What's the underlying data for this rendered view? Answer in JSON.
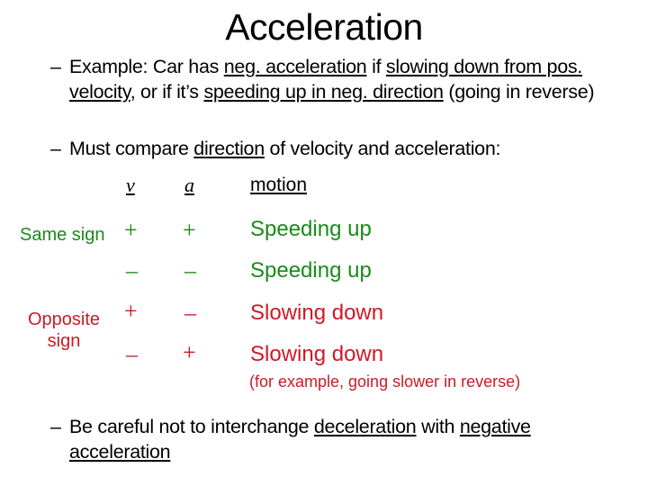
{
  "slide": {
    "title": "Acceleration",
    "bullets": [
      {
        "dash": "–",
        "segments": [
          {
            "text": "Example: Car has ",
            "underline": false
          },
          {
            "text": "neg. acceleration",
            "underline": true
          },
          {
            "text": " if ",
            "underline": false
          },
          {
            "text": "slowing down from pos. velocity",
            "underline": true
          },
          {
            "text": ", or if it’s ",
            "underline": false
          },
          {
            "text": "speeding up in neg. direction",
            "underline": true
          },
          {
            "text": " (going in reverse)",
            "underline": false
          }
        ]
      },
      {
        "dash": "–",
        "segments": [
          {
            "text": "Must compare ",
            "underline": false
          },
          {
            "text": "direction",
            "underline": true
          },
          {
            "text": " of velocity and acceleration:",
            "underline": false
          }
        ]
      },
      {
        "dash": "–",
        "segments": [
          {
            "text": "Be careful not to interchange ",
            "underline": false
          },
          {
            "text": "deceleration",
            "underline": true
          },
          {
            "text": " with ",
            "underline": false
          },
          {
            "text": "negative acceleration",
            "underline": true
          }
        ]
      }
    ],
    "table": {
      "headers": {
        "v": "v",
        "a": "a",
        "motion": "motion"
      },
      "groups": {
        "same": {
          "label": "Same sign",
          "color": "#1a8a1a"
        },
        "opposite": {
          "label": "Opposite sign",
          "label_line1": "Opposite",
          "label_line2": "sign",
          "color": "#cc1a26"
        }
      },
      "rows": [
        {
          "v": "+",
          "a": "+",
          "motion": "Speeding up",
          "group": "same"
        },
        {
          "v": "–",
          "a": "–",
          "motion": "Speeding up",
          "group": "same"
        },
        {
          "v": "+",
          "a": "–",
          "motion": "Slowing down",
          "group": "opposite"
        },
        {
          "v": "–",
          "a": "+",
          "motion": "Slowing down",
          "group": "opposite"
        }
      ],
      "note": "(for example, going slower in reverse)"
    }
  }
}
